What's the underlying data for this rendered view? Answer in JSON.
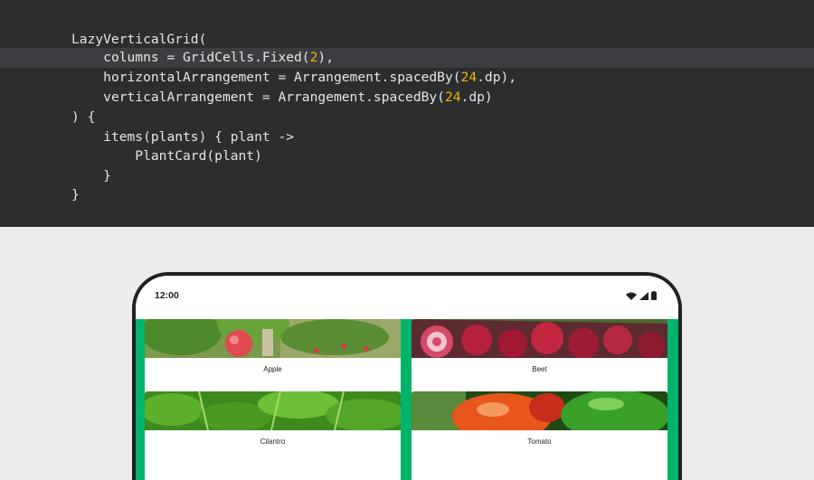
{
  "code": {
    "lines": [
      {
        "indent": "",
        "text": "LazyVerticalGrid("
      },
      {
        "indent": "    ",
        "highlight": true,
        "parts": [
          [
            "columns = GridCells.Fixed(",
            ""
          ],
          [
            "2",
            "num"
          ],
          [
            "),",
            ""
          ]
        ]
      },
      {
        "indent": "    ",
        "parts": [
          [
            "horizontalArrangement = Arrangement.spacedBy(",
            ""
          ],
          [
            "24",
            "num"
          ],
          [
            ".dp),",
            ""
          ]
        ]
      },
      {
        "indent": "    ",
        "parts": [
          [
            "verticalArrangement = Arrangement.spacedBy(",
            ""
          ],
          [
            "24",
            "num"
          ],
          [
            ".dp)",
            ""
          ]
        ]
      },
      {
        "indent": "",
        "text": ") {"
      },
      {
        "indent": "    ",
        "text": "items(plants) { plant ->"
      },
      {
        "indent": "        ",
        "text": "PlantCard(plant)"
      },
      {
        "indent": "    ",
        "text": "}"
      },
      {
        "indent": "",
        "text": "}"
      }
    ]
  },
  "phone": {
    "status": {
      "time": "12:00",
      "icons": [
        "wifi-icon",
        "cellular-signal-icon",
        "battery-icon"
      ]
    },
    "grid": {
      "background_color": "#00b46c",
      "cards": [
        {
          "label": "Apple"
        },
        {
          "label": "Beet"
        },
        {
          "label": "Cilantro"
        },
        {
          "label": "Tomato"
        }
      ]
    }
  }
}
